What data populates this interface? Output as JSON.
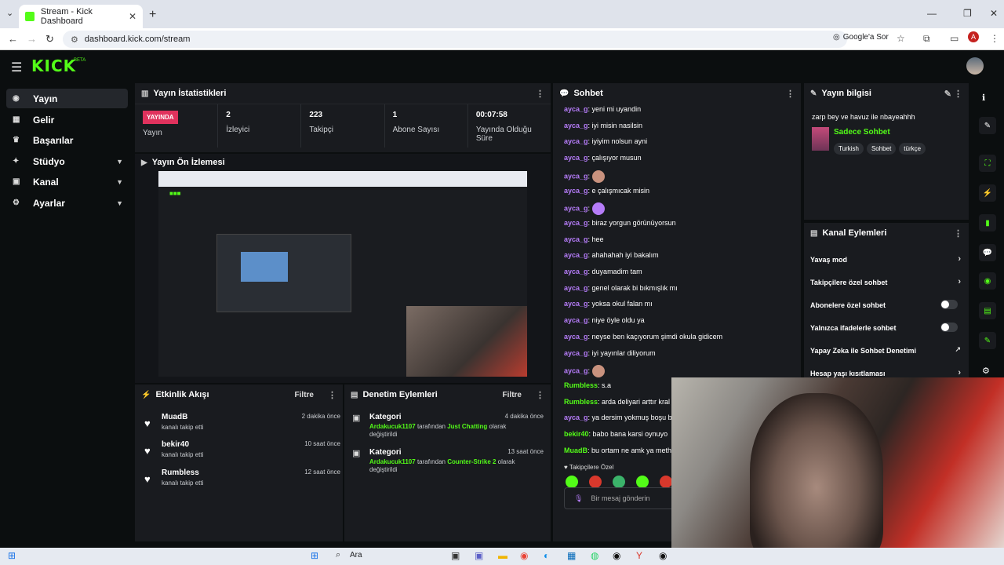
{
  "browser": {
    "tab_title": "Stream - Kick Dashboard",
    "url": "dashboard.kick.com/stream",
    "google_label": "Google'a Sor",
    "profile_initial": "A"
  },
  "kick": {
    "logo": "KICK",
    "beta": "BETA"
  },
  "sidebar": {
    "items": [
      {
        "label": "Yayın",
        "icon": "stream-icon"
      },
      {
        "label": "Gelir",
        "icon": "revenue-icon"
      },
      {
        "label": "Başarılar",
        "icon": "trophy-icon"
      },
      {
        "label": "Stüdyo",
        "icon": "studio-icon"
      },
      {
        "label": "Kanal",
        "icon": "channel-icon"
      },
      {
        "label": "Ayarlar",
        "icon": "gear-icon"
      }
    ]
  },
  "stats": {
    "title": "Yayın İstatistikleri",
    "live_badge": "YAYINDA",
    "live_label": "Yayın",
    "items": [
      {
        "value": "2",
        "label": "İzleyici"
      },
      {
        "value": "223",
        "label": "Takipçi"
      },
      {
        "value": "1",
        "label": "Abone Sayısı"
      },
      {
        "value": "00:07:58",
        "label": "Yayında Olduğu Süre"
      }
    ]
  },
  "preview": {
    "title": "Yayın Ön İzlemesi"
  },
  "activity": {
    "title": "Etkinlik Akışı",
    "filter": "Filtre",
    "rows": [
      {
        "name": "MuadB",
        "sub": "kanalı takip etti",
        "time": "2 dakika önce"
      },
      {
        "name": "bekir40",
        "sub": "kanalı takip etti",
        "time": "10 saat önce"
      },
      {
        "name": "Rumbless",
        "sub": "kanalı takip etti",
        "time": "12 saat önce"
      }
    ]
  },
  "moderation": {
    "title": "Denetim Eylemleri",
    "filter": "Filtre",
    "rows": [
      {
        "title": "Kategori",
        "time": "4 dakika önce",
        "user": "Ardakucuk1107",
        "mid": "tarafından",
        "value": "Just Chatting",
        "end": "olarak değiştirildi"
      },
      {
        "title": "Kategori",
        "time": "13 saat önce",
        "user": "Ardakucuk1107",
        "mid": "tarafından",
        "value": "Counter-Strike 2",
        "end": "olarak değiştirildi"
      }
    ]
  },
  "chat": {
    "title": "Sohbet",
    "messages": [
      {
        "user": "ayca_g",
        "text": "yeni mi uyandin"
      },
      {
        "user": "ayca_g",
        "text": "iyi misin nasilsin"
      },
      {
        "user": "ayca_g",
        "text": "iyiyim nolsun ayni"
      },
      {
        "user": "ayca_g",
        "text": "çalışıyor musun"
      },
      {
        "user": "ayca_g",
        "text": ""
      },
      {
        "user": "ayca_g",
        "text": "e çalışmıcak misin"
      },
      {
        "user": "ayca_g",
        "text": ""
      },
      {
        "user": "ayca_g",
        "text": "biraz yorgun görünüyorsun"
      },
      {
        "user": "ayca_g",
        "text": "hee"
      },
      {
        "user": "ayca_g",
        "text": "ahahahah iyi bakalım"
      },
      {
        "user": "ayca_g",
        "text": "duyamadim tam"
      },
      {
        "user": "ayca_g",
        "text": "genel olarak bi bıkmışlık mı"
      },
      {
        "user": "ayca_g",
        "text": "yoksa okul falan mı"
      },
      {
        "user": "ayca_g",
        "text": "niye öyle oldu ya"
      },
      {
        "user": "ayca_g",
        "text": "neyse ben kaçıyorum şimdi okula gidicem"
      },
      {
        "user": "ayca_g",
        "text": "iyi yayınlar diliyorum"
      },
      {
        "user": "ayca_g",
        "text": ""
      },
      {
        "user": "Rumbless",
        "text": "s.a"
      },
      {
        "user": "Rumbless",
        "text": "arda deliyari arttır kral"
      },
      {
        "user": "ayca_g",
        "text": "ya dersim yokmuş boşu b"
      },
      {
        "user": "bekir40",
        "text": "babo bana karsi oynuyo"
      },
      {
        "user": "MuadB",
        "text": "bu ortam ne amk ya meth"
      }
    ],
    "followers_only": "Takipçilere Özel",
    "placeholder": "Bir mesaj gönderin"
  },
  "stream_info": {
    "title": "Yayın bilgisi",
    "stream_title": "zarp bey ve havuz ile nbayeahhh",
    "category": "Sadece Sohbet",
    "tags": [
      "Turkish",
      "Sohbet",
      "türkçe"
    ]
  },
  "channel_actions": {
    "title": "Kanal Eylemleri",
    "items": [
      {
        "label": "Yavaş mod",
        "type": "chevron"
      },
      {
        "label": "Takipçilere özel sohbet",
        "type": "chevron"
      },
      {
        "label": "Abonelere özel sohbet",
        "type": "toggle"
      },
      {
        "label": "Yalnızca ifadelerle sohbet",
        "type": "toggle"
      },
      {
        "label": "Yapay Zeka ile Sohbet Denetimi",
        "type": "external"
      },
      {
        "label": "Hesap yaşı kısıtlaması",
        "type": "chevron"
      }
    ]
  },
  "taskbar": {
    "search": "Ara"
  }
}
